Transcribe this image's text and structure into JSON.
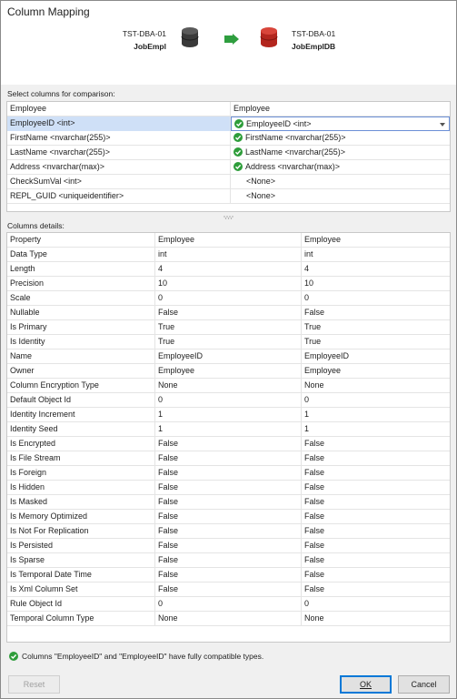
{
  "window": {
    "title": "Column Mapping"
  },
  "source": {
    "server": "TST-DBA-01",
    "database": "JobEmpl"
  },
  "target": {
    "server": "TST-DBA-01",
    "database": "JobEmplDB"
  },
  "mapping": {
    "label": "Select columns for comparison:",
    "headers": [
      "Employee",
      "Employee"
    ],
    "rows": [
      {
        "left": "EmployeeID <int>",
        "right": "EmployeeID <int>",
        "check": true,
        "selected": true
      },
      {
        "left": "FirstName <nvarchar(255)>",
        "right": "FirstName <nvarchar(255)>",
        "check": true,
        "selected": false
      },
      {
        "left": "LastName <nvarchar(255)>",
        "right": "LastName <nvarchar(255)>",
        "check": true,
        "selected": false
      },
      {
        "left": "Address <nvarchar(max)>",
        "right": "Address <nvarchar(max)>",
        "check": true,
        "selected": false
      },
      {
        "left": "CheckSumVal <int>",
        "right": "<None>",
        "check": false,
        "selected": false
      },
      {
        "left": "REPL_GUID <uniqueidentifier>",
        "right": "<None>",
        "check": false,
        "selected": false
      }
    ]
  },
  "details": {
    "label": "Columns details:",
    "headers": [
      "Property",
      "Employee",
      "Employee"
    ],
    "rows": [
      [
        "Data Type",
        "int",
        "int"
      ],
      [
        "Length",
        "4",
        "4"
      ],
      [
        "Precision",
        "10",
        "10"
      ],
      [
        "Scale",
        "0",
        "0"
      ],
      [
        "Nullable",
        "False",
        "False"
      ],
      [
        "Is Primary",
        "True",
        "True"
      ],
      [
        "Is Identity",
        "True",
        "True"
      ],
      [
        "Name",
        "EmployeeID",
        "EmployeeID"
      ],
      [
        "Owner",
        "Employee",
        "Employee"
      ],
      [
        "Column Encryption Type",
        "None",
        "None"
      ],
      [
        "Default Object Id",
        "0",
        "0"
      ],
      [
        "Identity Increment",
        "1",
        "1"
      ],
      [
        "Identity Seed",
        "1",
        "1"
      ],
      [
        "Is Encrypted",
        "False",
        "False"
      ],
      [
        "Is File Stream",
        "False",
        "False"
      ],
      [
        "Is Foreign",
        "False",
        "False"
      ],
      [
        "Is Hidden",
        "False",
        "False"
      ],
      [
        "Is Masked",
        "False",
        "False"
      ],
      [
        "Is Memory Optimized",
        "False",
        "False"
      ],
      [
        "Is Not For Replication",
        "False",
        "False"
      ],
      [
        "Is Persisted",
        "False",
        "False"
      ],
      [
        "Is Sparse",
        "False",
        "False"
      ],
      [
        "Is Temporal Date Time",
        "False",
        "False"
      ],
      [
        "Is Xml Column Set",
        "False",
        "False"
      ],
      [
        "Rule Object Id",
        "0",
        "0"
      ],
      [
        "Temporal Column Type",
        "None",
        "None"
      ]
    ]
  },
  "status": {
    "message": "Columns \"EmployeeID\" and \"EmployeeID\" have fully compatible types."
  },
  "buttons": {
    "reset": "Reset",
    "ok": "OK",
    "cancel": "Cancel"
  },
  "colors": {
    "check": "#2e9d3a",
    "source_db": "#3a3a3a",
    "target_db": "#b3261e",
    "arrow": "#2f9e3f",
    "selection": "#cfe0f7"
  },
  "icons": {
    "check": "check-circle-icon",
    "source_db": "database-icon",
    "target_db": "database-icon",
    "arrow": "arrow-right-icon",
    "dropdown": "chevron-down-icon"
  }
}
